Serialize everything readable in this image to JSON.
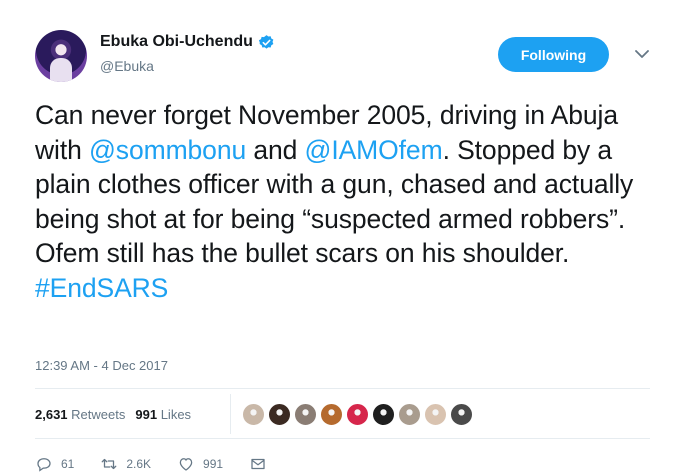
{
  "author": {
    "display_name": "Ebuka Obi-Uchendu",
    "handle": "@Ebuka",
    "verified": true
  },
  "follow_button": {
    "label": "Following"
  },
  "tweet": {
    "segments": [
      {
        "text": "Can never forget November 2005, driving in Abuja with ",
        "link": false
      },
      {
        "text": "@sommbonu",
        "link": true
      },
      {
        "text": " and ",
        "link": false
      },
      {
        "text": "@IAMOfem",
        "link": true
      },
      {
        "text": ". Stopped by a plain clothes officer with a gun, chased and actually being shot at for being “suspected armed robbers”. Ofem still has the bullet scars on his shoulder. ",
        "link": false
      },
      {
        "text": "#EndSARS",
        "link": true
      }
    ]
  },
  "timestamp": "12:39 AM - 4 Dec 2017",
  "stats": {
    "retweets_count": "2,631",
    "retweets_label": "Retweets",
    "likes_count": "991",
    "likes_label": "Likes"
  },
  "likers": [
    "#c9b8a8",
    "#3b2a22",
    "#8a7d74",
    "#b56a2e",
    "#d6264b",
    "#1f1f1f",
    "#a99c8e",
    "#d9c3b0",
    "#4a4a4a"
  ],
  "actions": {
    "reply_count": "61",
    "retweet_count": "2.6K",
    "like_count": "991"
  },
  "colors": {
    "link": "#1da1f2",
    "muted": "#657786",
    "text": "#14171a"
  },
  "icons": [
    "verified-badge-icon",
    "chevron-down-icon",
    "reply-icon",
    "retweet-icon",
    "heart-icon",
    "envelope-icon"
  ]
}
